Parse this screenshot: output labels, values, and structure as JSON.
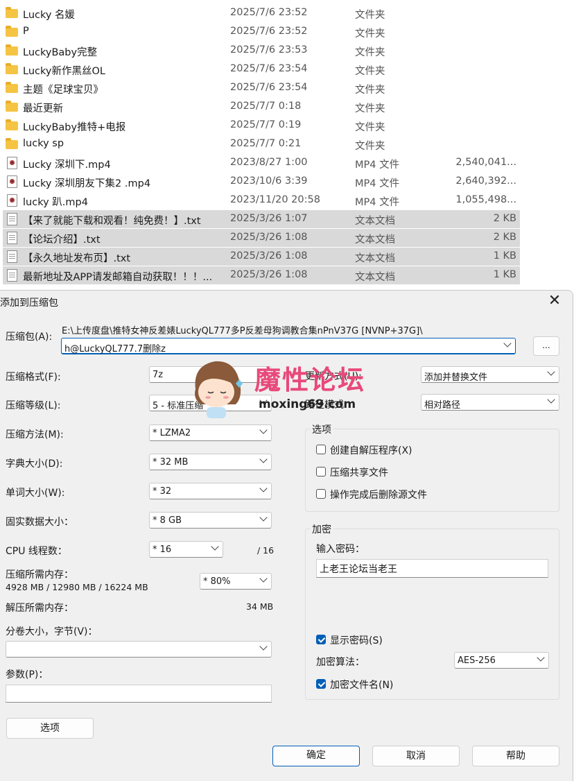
{
  "files": [
    {
      "icon": "folder-icon",
      "name": "Lucky 名媛",
      "date": "2025/7/6 23:52",
      "type": "文件夹",
      "size": "",
      "selected": false
    },
    {
      "icon": "folder-icon",
      "name": "P",
      "date": "2025/7/6 23:52",
      "type": "文件夹",
      "size": "",
      "selected": false
    },
    {
      "icon": "folder-icon",
      "name": "LuckyBaby完整",
      "date": "2025/7/6 23:53",
      "type": "文件夹",
      "size": "",
      "selected": false
    },
    {
      "icon": "folder-icon",
      "name": "Lucky新作黑丝OL",
      "date": "2025/7/6 23:54",
      "type": "文件夹",
      "size": "",
      "selected": false
    },
    {
      "icon": "folder-icon",
      "name": "主题《足球宝贝》",
      "date": "2025/7/6 23:54",
      "type": "文件夹",
      "size": "",
      "selected": false
    },
    {
      "icon": "folder-icon",
      "name": "最近更新",
      "date": "2025/7/7 0:18",
      "type": "文件夹",
      "size": "",
      "selected": false
    },
    {
      "icon": "folder-icon",
      "name": "LuckyBaby推特+电报",
      "date": "2025/7/7 0:19",
      "type": "文件夹",
      "size": "",
      "selected": false
    },
    {
      "icon": "folder-icon",
      "name": "lucky sp",
      "date": "2025/7/7 0:21",
      "type": "文件夹",
      "size": "",
      "selected": false
    },
    {
      "icon": "mp4-file-icon",
      "name": "Lucky 深圳下.mp4",
      "date": "2023/8/27 1:00",
      "type": "MP4 文件",
      "size": "2,540,041...",
      "selected": false
    },
    {
      "icon": "mp4-file-icon",
      "name": "Lucky 深圳朋友下集2 .mp4",
      "date": "2023/10/6 3:39",
      "type": "MP4 文件",
      "size": "2,640,392...",
      "selected": false
    },
    {
      "icon": "mp4-file-icon",
      "name": "lucky 趴.mp4",
      "date": "2023/11/20 20:58",
      "type": "MP4 文件",
      "size": "1,055,498...",
      "selected": false
    },
    {
      "icon": "text-file-icon",
      "name": "【来了就能下载和观看！纯免费！】.txt",
      "date": "2025/3/26 1:07",
      "type": "文本文档",
      "size": "2 KB",
      "selected": true
    },
    {
      "icon": "text-file-icon",
      "name": "【论坛介绍】.txt",
      "date": "2025/3/26 1:08",
      "type": "文本文档",
      "size": "2 KB",
      "selected": true
    },
    {
      "icon": "text-file-icon",
      "name": "【永久地址发布页】.txt",
      "date": "2025/3/26 1:08",
      "type": "文本文档",
      "size": "1 KB",
      "selected": true
    },
    {
      "icon": "text-file-icon",
      "name": "最新地址及APP请发邮箱自动获取！！！...",
      "date": "2025/3/26 1:08",
      "type": "文本文档",
      "size": "1 KB",
      "selected": true
    }
  ],
  "dialog": {
    "title": "添加到压缩包",
    "archive_label": "压缩包(A):",
    "archive_path": "E:\\上传度盘\\推特女神反差婊LuckyQL777多P反差母狗调教合集nPnV37G [NVNP+37G]\\",
    "archive_name": "h@LuckyQL777.7删除z",
    "browse_label": "...",
    "format_label": "压缩格式(F):",
    "format_value": "7z",
    "level_label": "压缩等级(L):",
    "level_value": "5 - 标准压缩",
    "method_label": "压缩方法(M):",
    "method_value": "*  LZMA2",
    "dict_label": "字典大小(D):",
    "dict_value": "*  32 MB",
    "word_label": "单词大小(W):",
    "word_value": "*  32",
    "solid_label": "固实数据大小：",
    "solid_value": "*  8 GB",
    "cpu_label": "CPU 线程数：",
    "cpu_value": "*  16",
    "cpu_total": "/ 16",
    "mem_label": "压缩所需内存：",
    "mem_detail": "4928 MB / 12980 MB / 16224 MB",
    "mem_value": "*  80%",
    "decomp_label": "解压所需内存：",
    "decomp_value": "34 MB",
    "volume_label": "分卷大小，字节(V)：",
    "volume_value": "",
    "params_label": "参数(P)：",
    "params_value": "",
    "options_button": "选项",
    "update_label": "更新方式(U):",
    "update_value": "添加并替换文件",
    "pathmode_label": "路径模式",
    "pathmode_value": "相对路径",
    "options_group": "选项",
    "opt_sfx": "创建自解压程序(X)",
    "opt_sfx_checked": false,
    "opt_shared": "压缩共享文件",
    "opt_shared_checked": false,
    "opt_delete": "操作完成后删除源文件",
    "opt_delete_checked": false,
    "encrypt_group": "加密",
    "password_label": "输入密码：",
    "password_value": "上老王论坛当老王",
    "show_password": "显示密码(S)",
    "show_password_checked": true,
    "enc_method_label": "加密算法：",
    "enc_method_value": "AES-256",
    "encrypt_names": "加密文件名(N)",
    "encrypt_names_checked": true,
    "ok_button": "确定",
    "cancel_button": "取消",
    "help_button": "帮助"
  },
  "watermark": {
    "text": "魔性论坛",
    "url": "moxing69.com"
  }
}
